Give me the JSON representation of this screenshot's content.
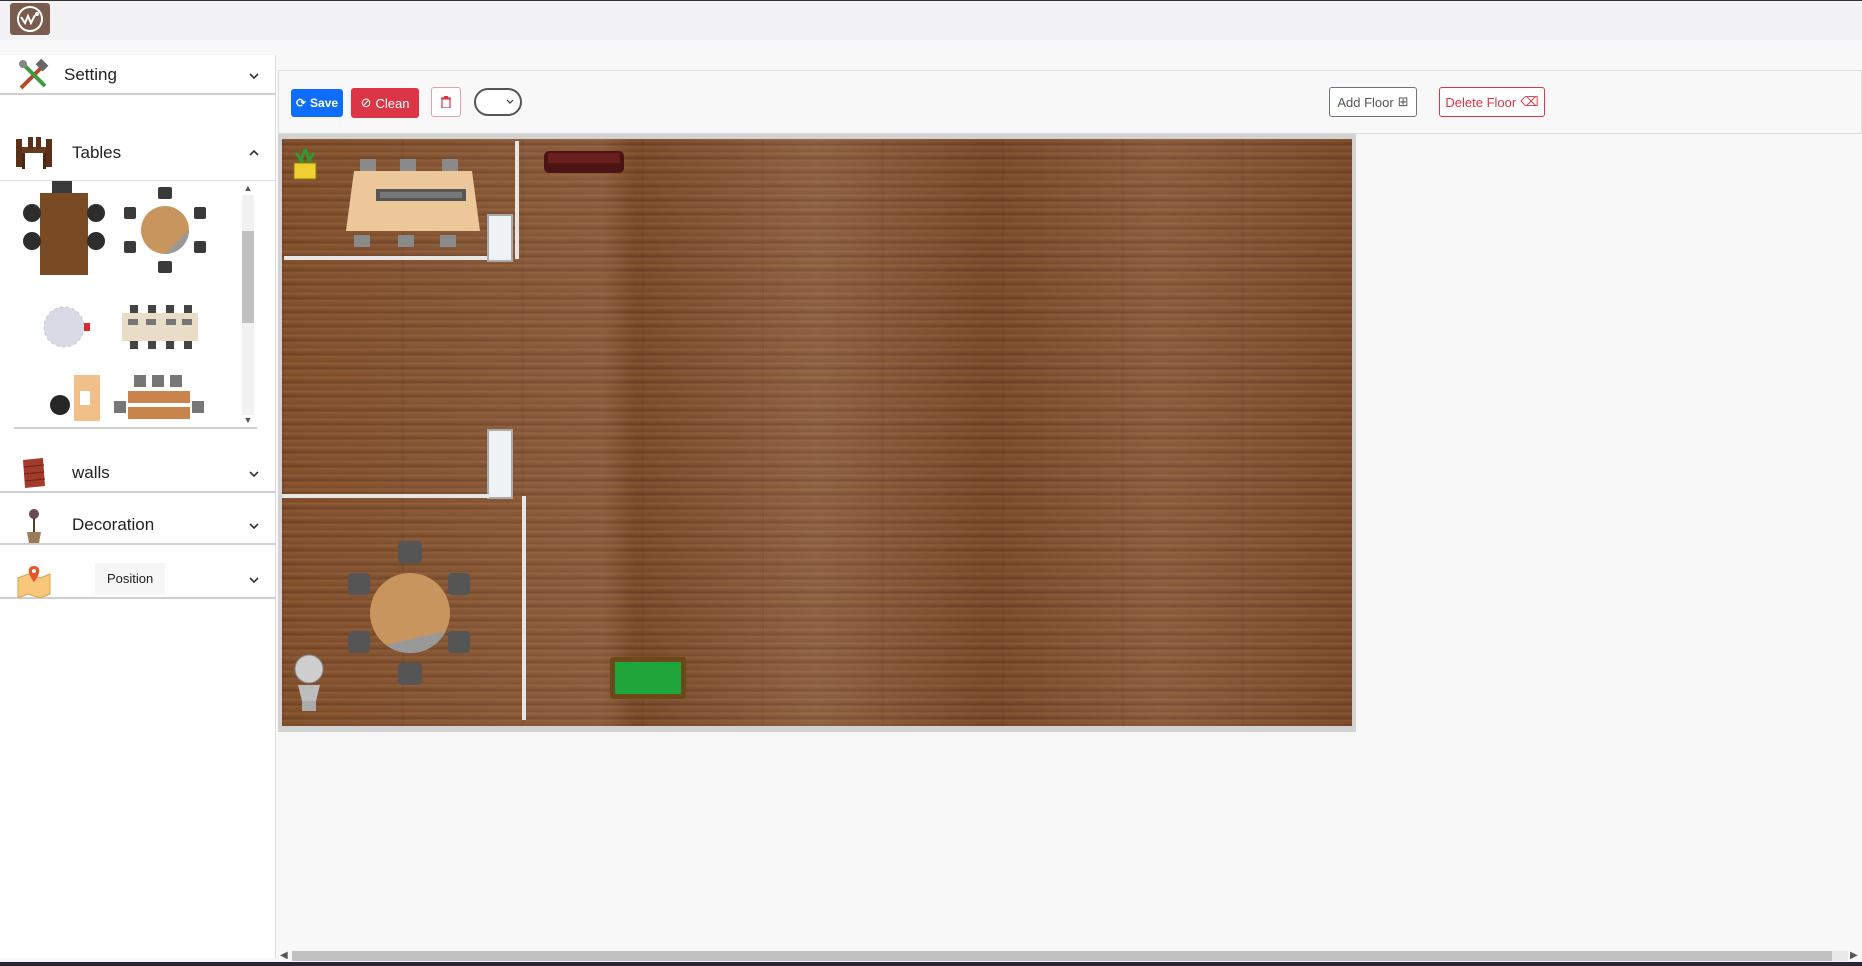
{
  "app": {
    "logo_icon": "brand-logo-icon"
  },
  "sidebar": {
    "setting": {
      "label": "Setting",
      "icon": "tools-icon"
    },
    "tables": {
      "label": "Tables",
      "icon": "dining-table-icon"
    },
    "walls": {
      "label": "walls",
      "icon": "brick-wall-icon"
    },
    "decoration": {
      "label": "Decoration",
      "icon": "plant-pot-icon"
    },
    "position": {
      "label": "Position",
      "icon": "map-pin-icon"
    }
  },
  "toolbar": {
    "save_label": "Save",
    "clean_label": "Clean",
    "add_floor_label": "Add Floor",
    "delete_floor_label": "Delete Floor",
    "colors": {
      "primary": "#0d6efd",
      "danger": "#dc3545",
      "secondary": "#6c757d"
    }
  }
}
